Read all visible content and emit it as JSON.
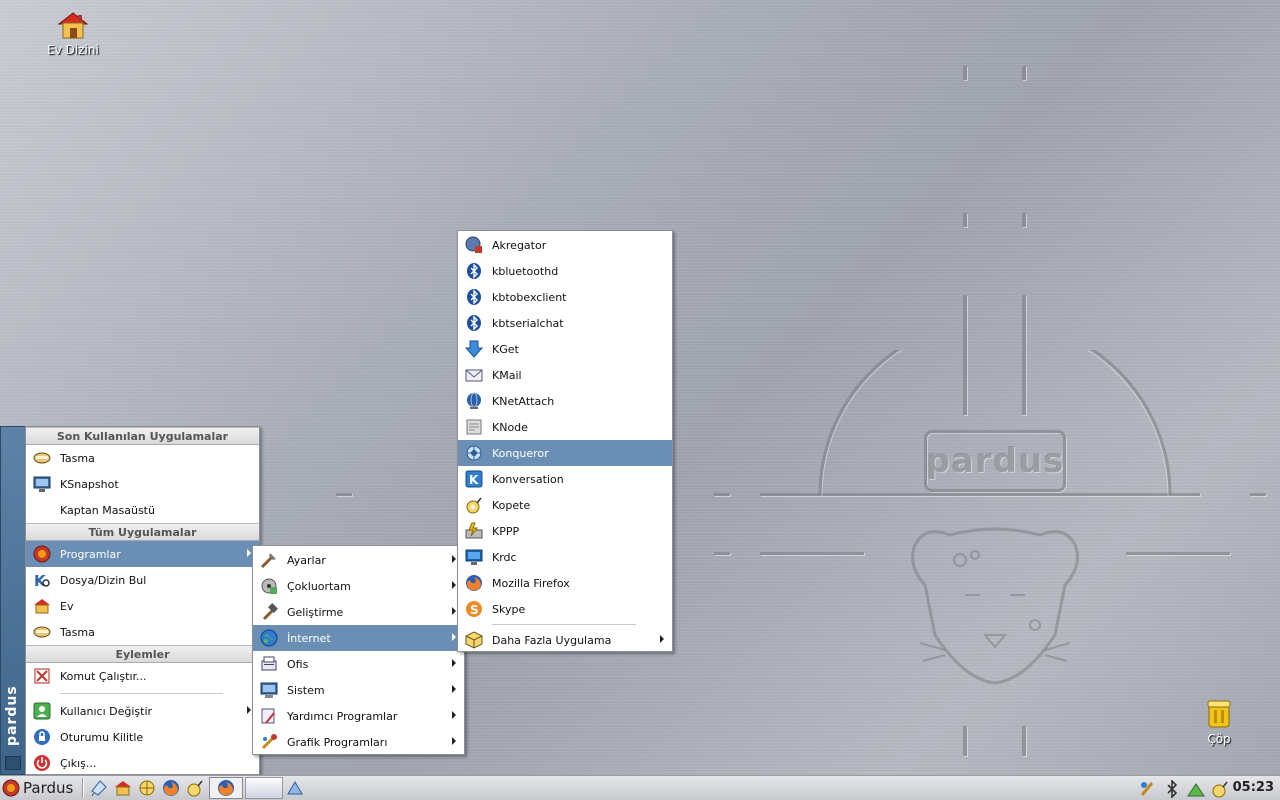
{
  "desktop": {
    "icons": [
      {
        "label": "Ev Dizini",
        "icon": "home-icon"
      },
      {
        "label": "Çöp",
        "icon": "trash-icon"
      }
    ],
    "wallpaper_logo": "pardus"
  },
  "kmenu": {
    "sections": {
      "recent_header": "Son Kullanılan Uygulamalar",
      "all_header": "Tüm Uygulamalar",
      "actions_header": "Eylemler"
    },
    "recent_items": [
      {
        "label": "Tasma",
        "icon": "tasma-icon"
      },
      {
        "label": "KSnapshot",
        "icon": "ksnapshot-icon"
      },
      {
        "label": "Kaptan Masaüstü",
        "icon": ""
      }
    ],
    "all_items": [
      {
        "label": "Programlar",
        "icon": "programs-icon",
        "submenu": true,
        "selected": true
      },
      {
        "label": "Dosya/Dizin Bul",
        "icon": "find-icon"
      },
      {
        "label": "Ev",
        "icon": "home-icon"
      },
      {
        "label": "Tasma",
        "icon": "tasma-icon"
      }
    ],
    "action_items": [
      {
        "label": "Komut Çalıştır...",
        "icon": "run-icon"
      },
      {
        "label": "Kullanıcı Değiştir",
        "icon": "switch-user-icon",
        "submenu": true
      },
      {
        "label": "Oturumu Kilitle",
        "icon": "lock-icon"
      },
      {
        "label": "Çıkış...",
        "icon": "logout-icon"
      }
    ],
    "side_label": "pardus"
  },
  "programs_menu": [
    {
      "label": "Ayarlar",
      "icon": "settings-icon"
    },
    {
      "label": "Çokluortam",
      "icon": "multimedia-icon"
    },
    {
      "label": "Geliştirme",
      "icon": "development-icon"
    },
    {
      "label": "İnternet",
      "icon": "internet-icon",
      "selected": true
    },
    {
      "label": "Ofis",
      "icon": "office-icon"
    },
    {
      "label": "Sistem",
      "icon": "system-icon"
    },
    {
      "label": "Yardımcı Programlar",
      "icon": "utilities-icon"
    },
    {
      "label": "Grafik Programları",
      "icon": "graphics-icon"
    }
  ],
  "internet_menu": {
    "items": [
      {
        "label": "Akregator",
        "icon": "akregator-icon"
      },
      {
        "label": "kbluetoothd",
        "icon": "bluetooth-icon"
      },
      {
        "label": "kbtobexclient",
        "icon": "bluetooth-icon"
      },
      {
        "label": "kbtserialchat",
        "icon": "bluetooth-icon"
      },
      {
        "label": "KGet",
        "icon": "kget-icon"
      },
      {
        "label": "KMail",
        "icon": "kmail-icon"
      },
      {
        "label": "KNetAttach",
        "icon": "knetattach-icon"
      },
      {
        "label": "KNode",
        "icon": "knode-icon"
      },
      {
        "label": "Konqueror",
        "icon": "konqueror-icon",
        "selected": true
      },
      {
        "label": "Konversation",
        "icon": "konversation-icon"
      },
      {
        "label": "Kopete",
        "icon": "kopete-icon"
      },
      {
        "label": "KPPP",
        "icon": "kppp-icon"
      },
      {
        "label": "Krdc",
        "icon": "krdc-icon"
      },
      {
        "label": "Mozilla Firefox",
        "icon": "firefox-icon"
      },
      {
        "label": "Skype",
        "icon": "skype-icon"
      }
    ],
    "more": {
      "label": "Daha Fazla Uygulama",
      "icon": "more-apps-icon"
    }
  },
  "taskbar": {
    "start_label": "Pardus",
    "quicklaunch": [
      "kaptan-icon",
      "home-icon",
      "konqueror-icon",
      "firefox-icon",
      "kopete-icon"
    ],
    "tray": [
      "tasma-tray-icon",
      "bluetooth-tray-icon",
      "network-tray-icon",
      "kopete-tray-icon"
    ],
    "clock": "05:23"
  },
  "colors": {
    "selection": "#6b8fb4",
    "kmenu_side": "#4b6f95"
  }
}
